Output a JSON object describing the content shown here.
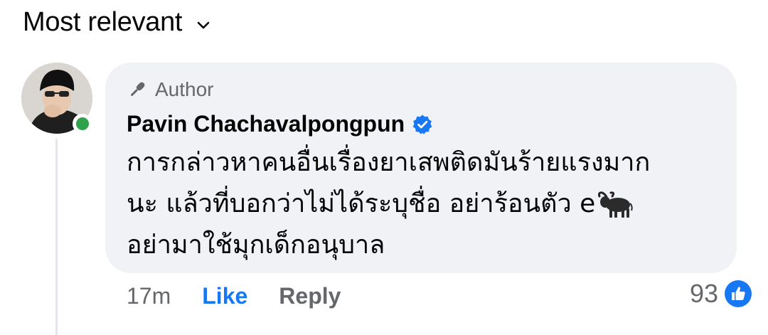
{
  "sort": {
    "label": "Most relevant",
    "chevron_icon": "chevron-down-icon"
  },
  "comment": {
    "avatar_icon": "profile-photo",
    "online": true,
    "badge": {
      "icon": "microphone-icon",
      "label": "Author"
    },
    "author_name": "Pavin Chachavalpongpun",
    "verified": true,
    "text_lines": [
      "การกล่าวหาคนอื่นเรื่องยาเสพติดมันร้ายแรงมาก",
      "นะ แล้วที่บอกว่าไม่ได้ระบุชื่อ อย่าร้อนตัว e",
      "อย่ามาใช้มุกเด็กอนุบาล"
    ],
    "emoji": "water-buffalo-emoji",
    "timestamp": "17m",
    "like_label": "Like",
    "reply_label": "Reply",
    "reaction_count": "93",
    "reaction_icon": "like-reaction-icon"
  },
  "colors": {
    "bubble_bg": "#f0f2f5",
    "link_blue": "#1877f2",
    "secondary_text": "#65676b",
    "online_green": "#31a24c"
  }
}
